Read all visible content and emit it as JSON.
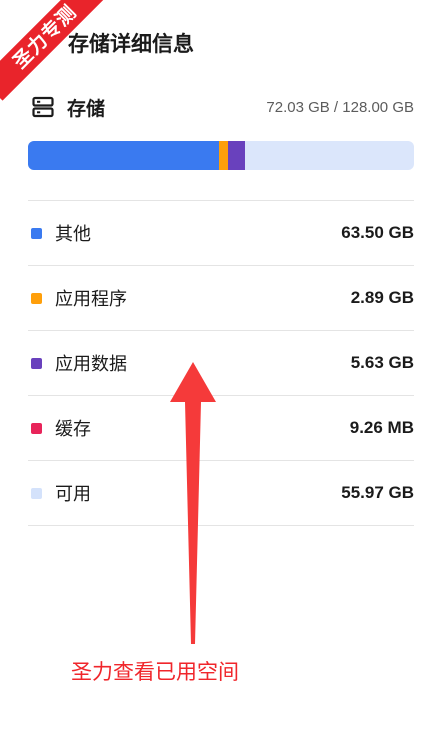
{
  "watermark": {
    "text": "圣力专测"
  },
  "page": {
    "title": "存储详细信息"
  },
  "storage": {
    "title": "存储",
    "usage": "72.03 GB / 128.00 GB",
    "icon": "storage-icon"
  },
  "usage_bar": {
    "segments": [
      {
        "name": "其他",
        "fraction": 0.4961,
        "color": "#3a7af0"
      },
      {
        "name": "应用程序",
        "fraction": 0.0226,
        "color": "#ff9f0a"
      },
      {
        "name": "应用数据",
        "fraction": 0.044,
        "color": "#6941bd"
      },
      {
        "name": "缓存",
        "fraction": 0.0001,
        "color": "#e8245a"
      }
    ],
    "track_color": "#dbe6fb"
  },
  "items": [
    {
      "label": "其他",
      "value": "63.50 GB",
      "color": "#3a7af0"
    },
    {
      "label": "应用程序",
      "value": "2.89 GB",
      "color": "#ff9f0a"
    },
    {
      "label": "应用数据",
      "value": "5.63 GB",
      "color": "#6941bd"
    },
    {
      "label": "缓存",
      "value": "9.26 MB",
      "color": "#e8245a"
    },
    {
      "label": "可用",
      "value": "55.97 GB",
      "color": "#d4e2fb"
    }
  ],
  "annotation": {
    "text": "圣力查看已用空间",
    "color": "#f0262b"
  }
}
